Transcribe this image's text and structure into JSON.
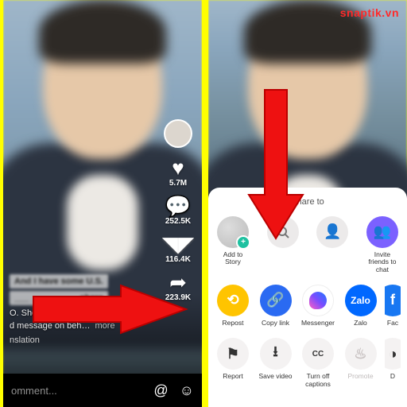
{
  "watermark": "snaptik.vn",
  "left": {
    "likes": "5.7M",
    "comments": "252.5K",
    "saves": "116.4K",
    "shares": "223.9K",
    "caption_blur1": "And I have some U.S.",
    "caption_blur2": "___ _______ __ share",
    "caption_sub": "O. Shou Chew, sh…",
    "caption_sub2": "d message on beh…",
    "more": "more",
    "translate": "nslation",
    "comment_placeholder": "omment..."
  },
  "right": {
    "share_title": "Share to",
    "row1": {
      "story": "Add to Story",
      "search": "",
      "contact": "",
      "invite": "Invite friends to chat"
    },
    "row2": {
      "repost": "Repost",
      "copy": "Copy link",
      "messenger": "Messenger",
      "zalo": "Zalo",
      "zalo_badge": "Zalo",
      "facebook": "Fac"
    },
    "row3": {
      "report": "Report",
      "save": "Save video",
      "captions": "Turn off captions",
      "promote": "Promote",
      "duet": "D"
    }
  }
}
